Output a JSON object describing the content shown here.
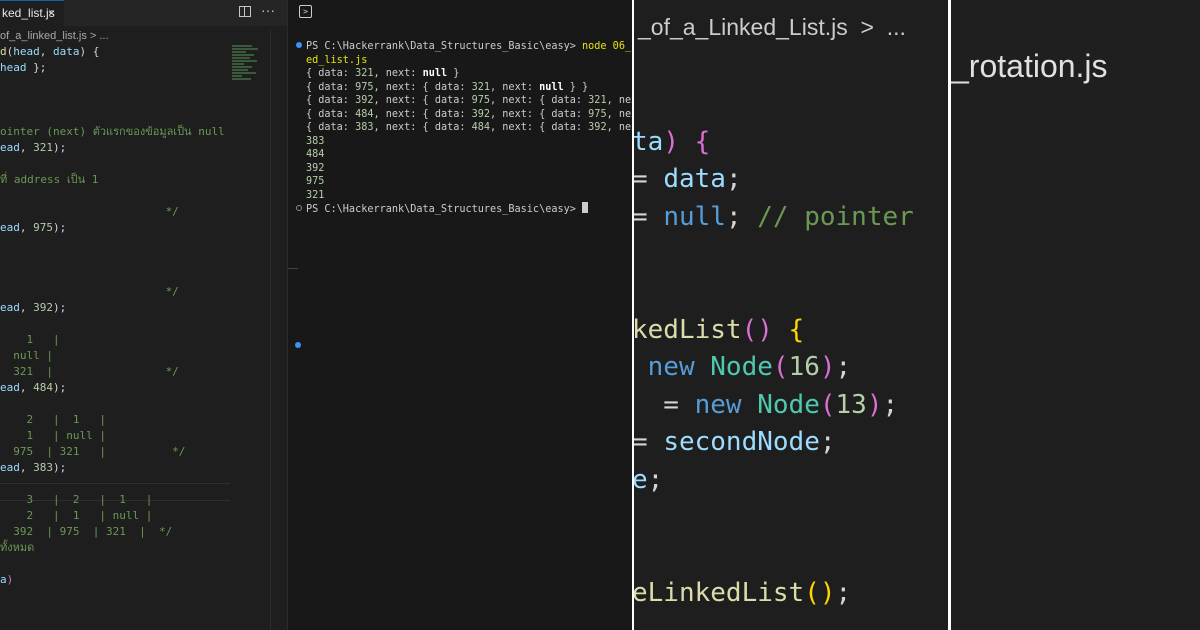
{
  "editor": {
    "tab_title": "ked_list.js",
    "close_glyph": "×",
    "more_glyph": "···",
    "breadcrumb": "of_a_linked_list.js > ...",
    "code_lines": [
      [
        [
          "c-fn",
          "d"
        ],
        [
          "c-pun",
          "("
        ],
        [
          "c-var",
          "head"
        ],
        [
          "c-pun",
          ", "
        ],
        [
          "c-var",
          "data"
        ],
        [
          "c-pun",
          ") {"
        ]
      ],
      [
        [
          "c-var",
          "head"
        ],
        [
          "c-pun",
          " };"
        ]
      ],
      [],
      [],
      [],
      [
        [
          "c-com",
          "ointer (next) ตัวแรกของข้อมูลเป็น null"
        ]
      ],
      [
        [
          "c-var",
          "ead"
        ],
        [
          "c-pun",
          ", "
        ],
        [
          "c-num",
          "321"
        ],
        [
          "c-pun",
          ");"
        ]
      ],
      [],
      [
        [
          "c-com",
          "ที่ address เป็น 1"
        ]
      ],
      [],
      [
        [
          "c-com",
          "                         */"
        ]
      ],
      [
        [
          "c-var",
          "ead"
        ],
        [
          "c-pun",
          ", "
        ],
        [
          "c-num",
          "975"
        ],
        [
          "c-pun",
          ");"
        ]
      ],
      [],
      [],
      [],
      [
        [
          "c-com",
          "                         */"
        ]
      ],
      [
        [
          "c-var",
          "ead"
        ],
        [
          "c-pun",
          ", "
        ],
        [
          "c-num",
          "392"
        ],
        [
          "c-pun",
          ");"
        ]
      ],
      [],
      [
        [
          "c-com",
          "    1   |"
        ]
      ],
      [
        [
          "c-com",
          "  null |"
        ]
      ],
      [
        [
          "c-com",
          "  321  |                 */"
        ]
      ],
      [
        [
          "c-var",
          "ead"
        ],
        [
          "c-pun",
          ", "
        ],
        [
          "c-num",
          "484"
        ],
        [
          "c-pun",
          ");"
        ]
      ],
      [],
      [
        [
          "c-com",
          "    2   |  1   |"
        ]
      ],
      [
        [
          "c-com",
          "    1   | null |"
        ]
      ],
      [
        [
          "c-com",
          "  975  | 321   |          */"
        ]
      ],
      [
        [
          "c-var",
          "ead"
        ],
        [
          "c-pun",
          ", "
        ],
        [
          "c-num",
          "383"
        ],
        [
          "c-pun",
          ");"
        ]
      ],
      [],
      [
        [
          "c-com",
          "    3   |  2   |  1   |"
        ]
      ],
      [
        [
          "c-com",
          "    2   |  1   | null |"
        ]
      ],
      [
        [
          "c-com",
          "  392  | 975  | 321  |  */"
        ]
      ],
      [
        [
          "c-com",
          "ทั้งหมด"
        ]
      ],
      [],
      [
        [
          "c-var",
          "a"
        ],
        [
          "c-br2",
          ")"
        ]
      ]
    ]
  },
  "terminal": {
    "lines": [
      {
        "dot": "blue",
        "parts": [
          [
            "",
            "PS C:\\Hackerrank\\Data_Structures_Basic\\easy> "
          ],
          [
            "t-y",
            "node 06_"
          ]
        ]
      },
      {
        "parts": [
          [
            "t-y",
            "ed_list.js"
          ]
        ]
      },
      {
        "parts": [
          [
            "",
            "{ data: "
          ],
          [
            "t-num",
            "321"
          ],
          [
            "",
            ", next: "
          ],
          [
            "t-kw",
            "null"
          ],
          [
            "",
            " }"
          ]
        ]
      },
      {
        "parts": [
          [
            "",
            "{ data: "
          ],
          [
            "t-num",
            "975"
          ],
          [
            "",
            ", next: { data: "
          ],
          [
            "t-num",
            "321"
          ],
          [
            "",
            ", next: "
          ],
          [
            "t-kw",
            "null"
          ],
          [
            "",
            " } }"
          ]
        ]
      },
      {
        "parts": [
          [
            "",
            "{ data: "
          ],
          [
            "t-num",
            "392"
          ],
          [
            "",
            ", next: { data: "
          ],
          [
            "t-num",
            "975"
          ],
          [
            "",
            ", next: { data: "
          ],
          [
            "t-num",
            "321"
          ],
          [
            "",
            ", next"
          ]
        ]
      },
      {
        "parts": [
          [
            "",
            "{ data: "
          ],
          [
            "t-num",
            "484"
          ],
          [
            "",
            ", next: { data: "
          ],
          [
            "t-num",
            "392"
          ],
          [
            "",
            ", next: { data: "
          ],
          [
            "t-num",
            "975"
          ],
          [
            "",
            ", nex"
          ]
        ]
      },
      {
        "parts": [
          [
            "",
            "{ data: "
          ],
          [
            "t-num",
            "383"
          ],
          [
            "",
            ", next: { data: "
          ],
          [
            "t-num",
            "484"
          ],
          [
            "",
            ", next: { data: "
          ],
          [
            "t-num",
            "392"
          ],
          [
            "",
            ", nex"
          ]
        ]
      },
      {
        "parts": [
          [
            "t-num",
            "383"
          ]
        ]
      },
      {
        "parts": [
          [
            "t-num",
            "484"
          ]
        ]
      },
      {
        "parts": [
          [
            "t-num",
            "392"
          ]
        ]
      },
      {
        "parts": [
          [
            "t-num",
            "975"
          ]
        ]
      },
      {
        "parts": [
          [
            "t-num",
            "321"
          ]
        ]
      },
      {
        "dot": "hollow",
        "cursor": true,
        "parts": [
          [
            "",
            "PS C:\\Hackerrank\\Data_Structures_Basic\\easy> "
          ]
        ]
      }
    ]
  },
  "zoom_editor": {
    "breadcrumb": "_of_a_Linked_List.js  >  ...",
    "code_lines": [
      [],
      [
        [
          "c-var",
          "ta"
        ],
        [
          "c-br2",
          ")"
        ],
        [
          "c-pun",
          " "
        ],
        [
          "c-br2",
          "{"
        ]
      ],
      [
        [
          "c-pun",
          "= "
        ],
        [
          "c-var",
          "data"
        ],
        [
          "c-pun",
          ";"
        ]
      ],
      [
        [
          "c-pun",
          "= "
        ],
        [
          "c-kw",
          "null"
        ],
        [
          "c-pun",
          "; "
        ],
        [
          "c-com",
          "// pointer"
        ]
      ],
      [],
      [],
      [
        [
          "c-fn",
          "kedList"
        ],
        [
          "c-br2",
          "()"
        ],
        [
          "c-pun",
          " "
        ],
        [
          "c-br",
          "{"
        ]
      ],
      [
        [
          "c-pun",
          " "
        ],
        [
          "c-kw",
          "new"
        ],
        [
          "c-pun",
          " "
        ],
        [
          "c-cls",
          "Node"
        ],
        [
          "c-br2",
          "("
        ],
        [
          "c-num",
          "16"
        ],
        [
          "c-br2",
          ")"
        ],
        [
          "c-pun",
          ";"
        ]
      ],
      [
        [
          "c-pun",
          "  = "
        ],
        [
          "c-kw",
          "new"
        ],
        [
          "c-pun",
          " "
        ],
        [
          "c-cls",
          "Node"
        ],
        [
          "c-br2",
          "("
        ],
        [
          "c-num",
          "13"
        ],
        [
          "c-br2",
          ")"
        ],
        [
          "c-pun",
          ";"
        ]
      ],
      [
        [
          "c-pun",
          "= "
        ],
        [
          "c-var",
          "secondNode"
        ],
        [
          "c-pun",
          ";"
        ]
      ],
      [
        [
          "c-var",
          "e"
        ],
        [
          "c-pun",
          ";"
        ]
      ],
      [],
      [],
      [
        [
          "c-fn",
          "eLinkedList"
        ],
        [
          "c-br",
          "()"
        ],
        [
          "c-pun",
          ";"
        ]
      ]
    ]
  },
  "zoom_tab": {
    "title": "_rotation.js"
  }
}
